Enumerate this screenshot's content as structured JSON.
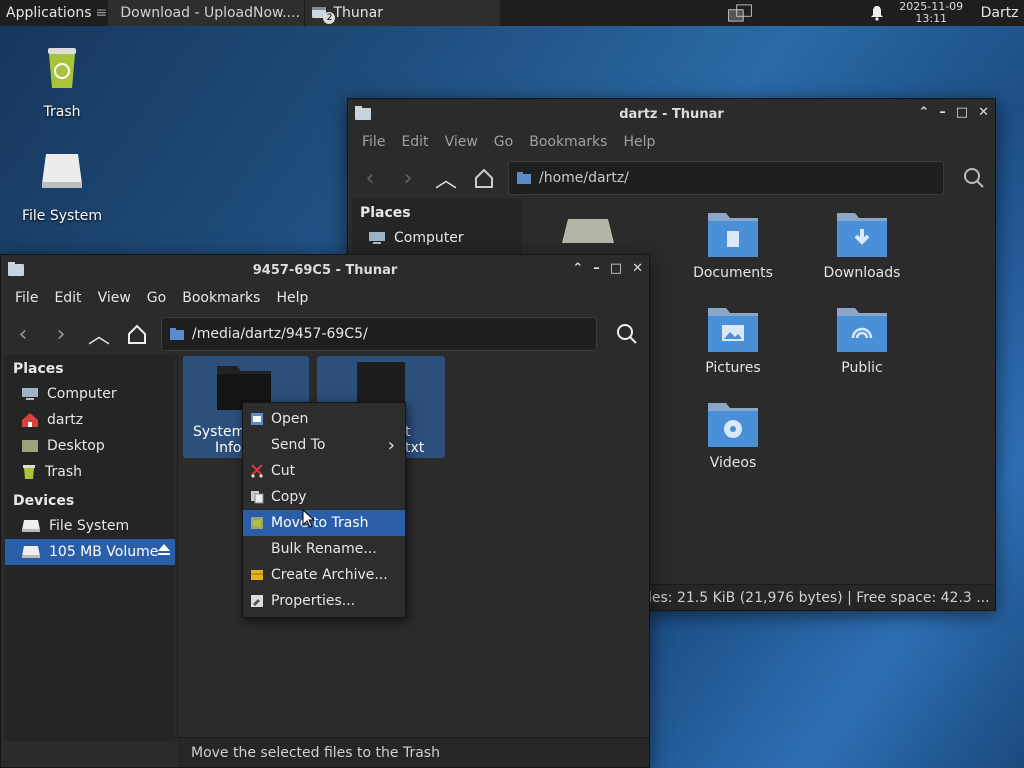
{
  "panel": {
    "apps_label": "Applications",
    "apps_sep": "≡",
    "task1": "Download - UploadNow....",
    "task2": "Thunar",
    "task2_count": "2",
    "date": "2025-11-09",
    "time": "13:11",
    "user": "Dartz"
  },
  "desktop": {
    "trash": "Trash",
    "filesystem": "File System"
  },
  "back_window": {
    "title": "dartz - Thunar",
    "menu": [
      "File",
      "Edit",
      "View",
      "Go",
      "Bookmarks",
      "Help"
    ],
    "path": "/home/dartz/",
    "places_header": "Places",
    "places_item": "Computer",
    "folders": [
      "Documents",
      "Downloads",
      "Pictures",
      "Public",
      "Videos"
    ],
    "status": "les: 21.5 KiB (21,976 bytes)  |  Free space: 42.3 ..."
  },
  "front_window": {
    "title": "9457-69C5 - Thunar",
    "menu": [
      "File",
      "Edit",
      "View",
      "Go",
      "Bookmarks",
      "Help"
    ],
    "path": "/media/dartz/9457-69C5/",
    "places_header": "Places",
    "places": [
      "Computer",
      "dartz",
      "Desktop",
      "Trash"
    ],
    "devices_header": "Devices",
    "devices": [
      "File System",
      "105 MB Volume"
    ],
    "file1_line1": "System",
    "file1_line2": "Inform",
    "file2_line1": "t",
    "file2_line2": "txt",
    "status": "Move the selected files to the Trash"
  },
  "context_menu": {
    "items": [
      "Open",
      "Send To",
      "Cut",
      "Copy",
      "Move to Trash",
      "Bulk Rename...",
      "Create Archive...",
      "Properties..."
    ],
    "submenu_arrow": "›",
    "highlighted": "Move to Trash"
  },
  "colors": {
    "selection": "#2a5ea8",
    "folder": "#4a90d9",
    "window_bg": "#2b2b2b"
  }
}
